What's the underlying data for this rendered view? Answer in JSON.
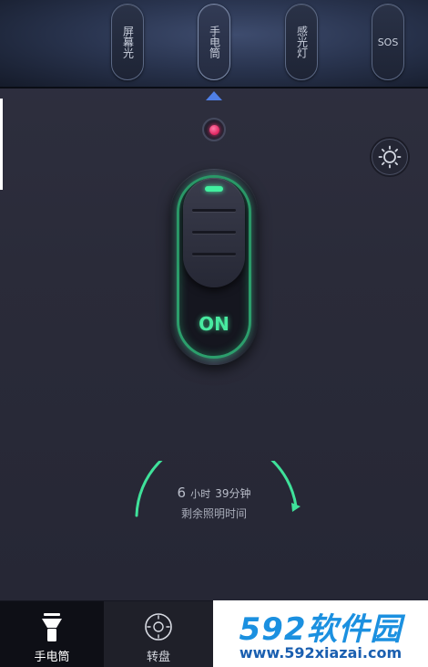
{
  "modes": {
    "tabs": [
      {
        "label": "屏幕光"
      },
      {
        "label": "手电筒"
      },
      {
        "label": "感光灯"
      },
      {
        "label": "SOS"
      }
    ]
  },
  "switch": {
    "state_label": "ON"
  },
  "timer": {
    "hours": "6",
    "hours_unit": "小时",
    "minutes": "39分钟",
    "caption": "剩余照明时间"
  },
  "bottom_nav": {
    "tabs": [
      {
        "label": "手电筒",
        "icon": "flashlight-icon"
      },
      {
        "label": "转盘",
        "icon": "dial-icon"
      }
    ]
  },
  "watermark": {
    "logo_digits": "592",
    "logo_text": "软件园",
    "url": "www.592xiazai.com"
  },
  "colors": {
    "accent_green": "#42f0a0",
    "indicator_blue": "#4f7fe6",
    "led_red": "#e0245f",
    "watermark_blue": "#1b90e0"
  }
}
